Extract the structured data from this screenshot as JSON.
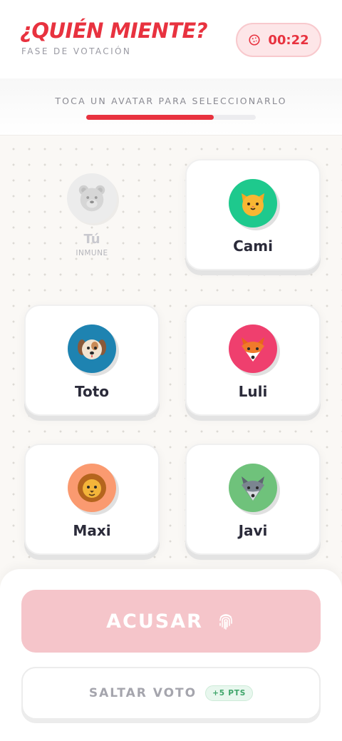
{
  "header": {
    "title": "¿QUIÉN MIENTE?",
    "subtitle": "FASE DE VOTACIÓN",
    "timer": "00:22"
  },
  "instruction": "TOCA UN AVATAR PARA SELECCIONARLO",
  "progress": 0.75,
  "self": {
    "name": "Tú",
    "status": "INMUNE",
    "avatar_icon": "bear-icon"
  },
  "players": [
    {
      "name": "Cami",
      "avatar_icon": "cat-icon",
      "color": "#1ec98d"
    },
    {
      "name": "Toto",
      "avatar_icon": "dog-icon",
      "color": "#1e83b1"
    },
    {
      "name": "Luli",
      "avatar_icon": "fox-icon",
      "color": "#ef3f6e"
    },
    {
      "name": "Maxi",
      "avatar_icon": "lion-icon",
      "color": "#fa9a70"
    },
    {
      "name": "Javi",
      "avatar_icon": "wolf-icon",
      "color": "#6fc27b"
    }
  ],
  "actions": {
    "accuse_label": "ACUSAR",
    "skip_label": "SALTAR VOTO",
    "skip_bonus": "+5 PTS"
  },
  "colors": {
    "accent": "#e8323f",
    "accuse_disabled": "#f5c5ca",
    "bonus_green": "#3fa56a"
  }
}
